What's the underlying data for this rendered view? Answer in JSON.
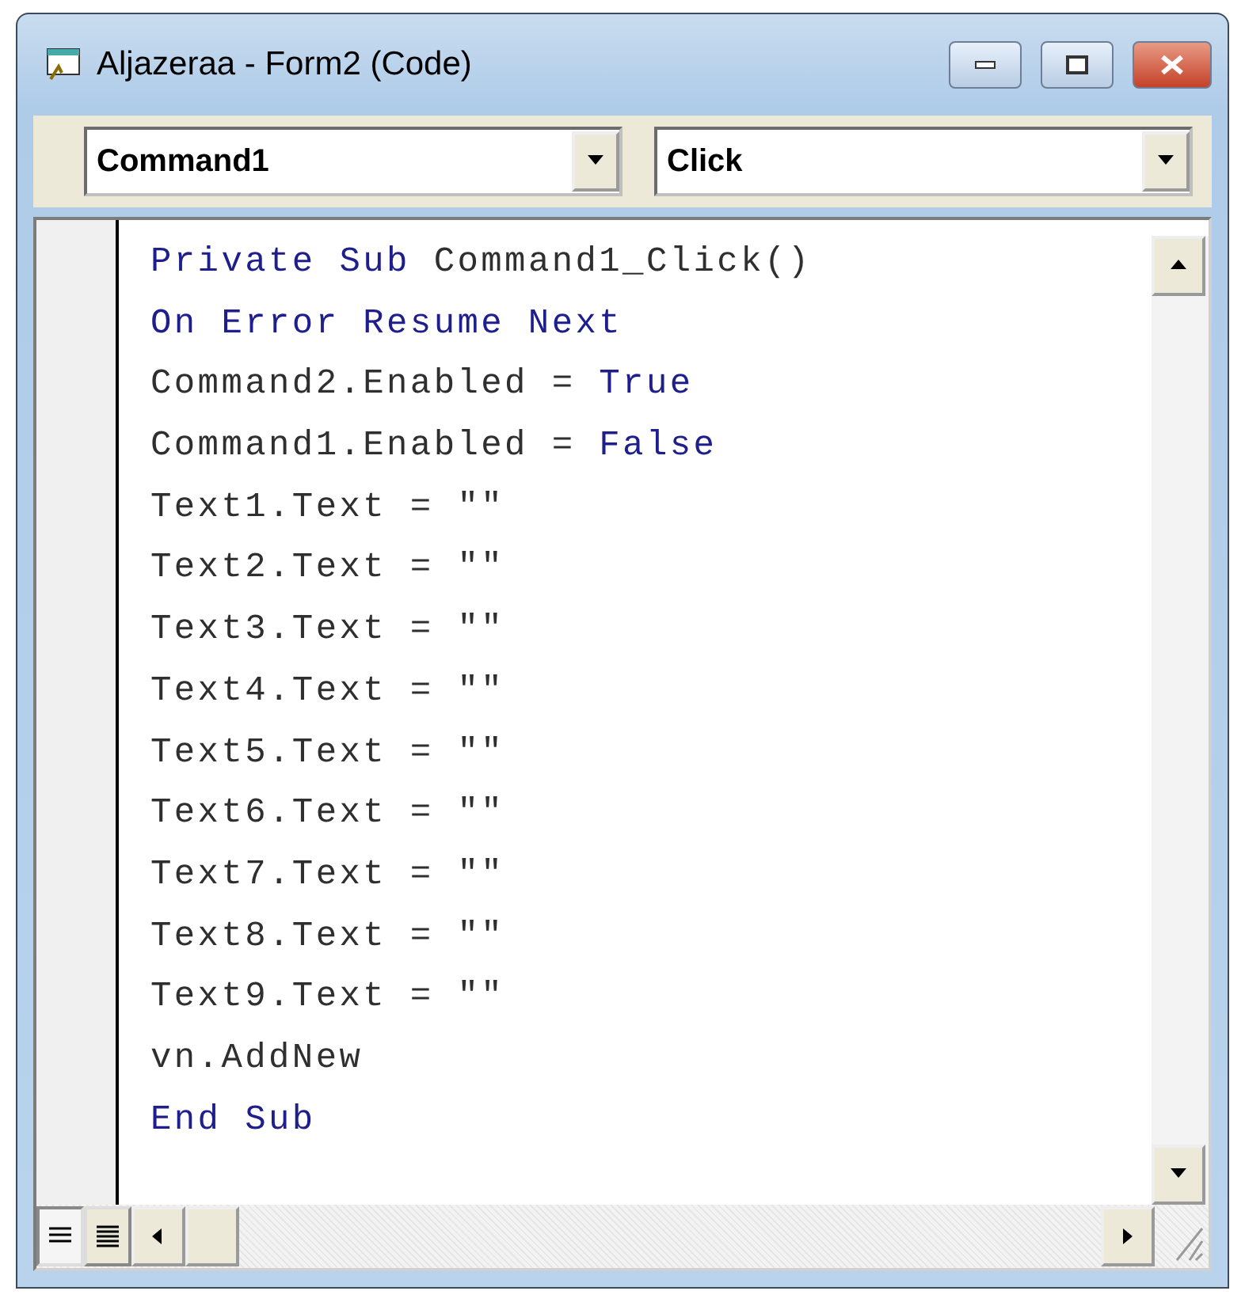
{
  "window": {
    "title": "Aljazeraa - Form2 (Code)"
  },
  "object_box": {
    "value": "Command1"
  },
  "procedure_box": {
    "value": "Click"
  },
  "code_lines": [
    [
      {
        "text": "Private Sub",
        "kind": "keyword"
      },
      {
        "text": " Command1_Click()",
        "kind": "plain"
      }
    ],
    [
      {
        "text": "On Error Resume Next",
        "kind": "keyword"
      }
    ],
    [
      {
        "text": "Command2.Enabled = ",
        "kind": "plain"
      },
      {
        "text": "True",
        "kind": "keyword"
      }
    ],
    [
      {
        "text": "Command1.Enabled = ",
        "kind": "plain"
      },
      {
        "text": "False",
        "kind": "keyword"
      }
    ],
    [
      {
        "text": "Text1.Text = \"\"",
        "kind": "plain"
      }
    ],
    [
      {
        "text": "Text2.Text = \"\"",
        "kind": "plain"
      }
    ],
    [
      {
        "text": "Text3.Text = \"\"",
        "kind": "plain"
      }
    ],
    [
      {
        "text": "Text4.Text = \"\"",
        "kind": "plain"
      }
    ],
    [
      {
        "text": "Text5.Text = \"\"",
        "kind": "plain"
      }
    ],
    [
      {
        "text": "Text6.Text = \"\"",
        "kind": "plain"
      }
    ],
    [
      {
        "text": "Text7.Text = \"\"",
        "kind": "plain"
      }
    ],
    [
      {
        "text": "Text8.Text = \"\"",
        "kind": "plain"
      }
    ],
    [
      {
        "text": "Text9.Text = \"\"",
        "kind": "plain"
      }
    ],
    [
      {
        "text": "vn.AddNew",
        "kind": "plain"
      }
    ],
    [
      {
        "text": "End Sub",
        "kind": "keyword"
      }
    ]
  ],
  "view_buttons": [
    {
      "kind": "procedure",
      "selected": true
    },
    {
      "kind": "full",
      "selected": false
    }
  ]
}
